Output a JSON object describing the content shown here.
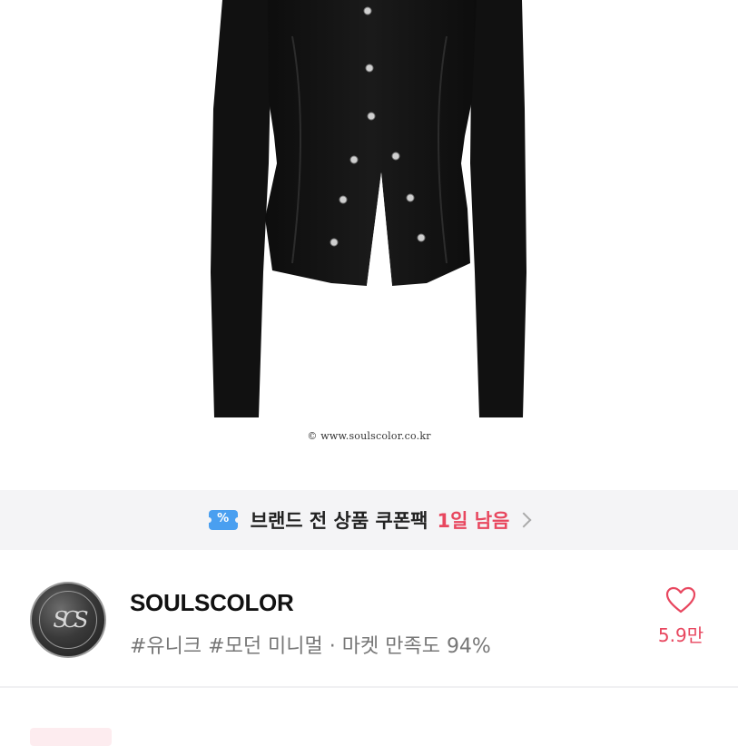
{
  "product": {
    "image_alt": "black fitted button cardigan",
    "watermark": "© www.soulscolor.co.kr"
  },
  "coupon_banner": {
    "icon": "coupon-ticket-icon",
    "icon_glyph": "%",
    "text": "브랜드 전 상품 쿠폰팩",
    "highlight": "1일 남음",
    "highlight_color": "#e8475f"
  },
  "shop": {
    "logo_text": "SCS",
    "name": "SOULSCOLOR",
    "tags": "#유니크 #모던 미니멀 · 마켓 만족도 94%",
    "like_icon": "heart-outline-icon",
    "like_count": "5.9만"
  },
  "colors": {
    "accent": "#e8475f",
    "coupon_blue": "#4a9ff0",
    "banner_bg": "#f4f4f6"
  }
}
